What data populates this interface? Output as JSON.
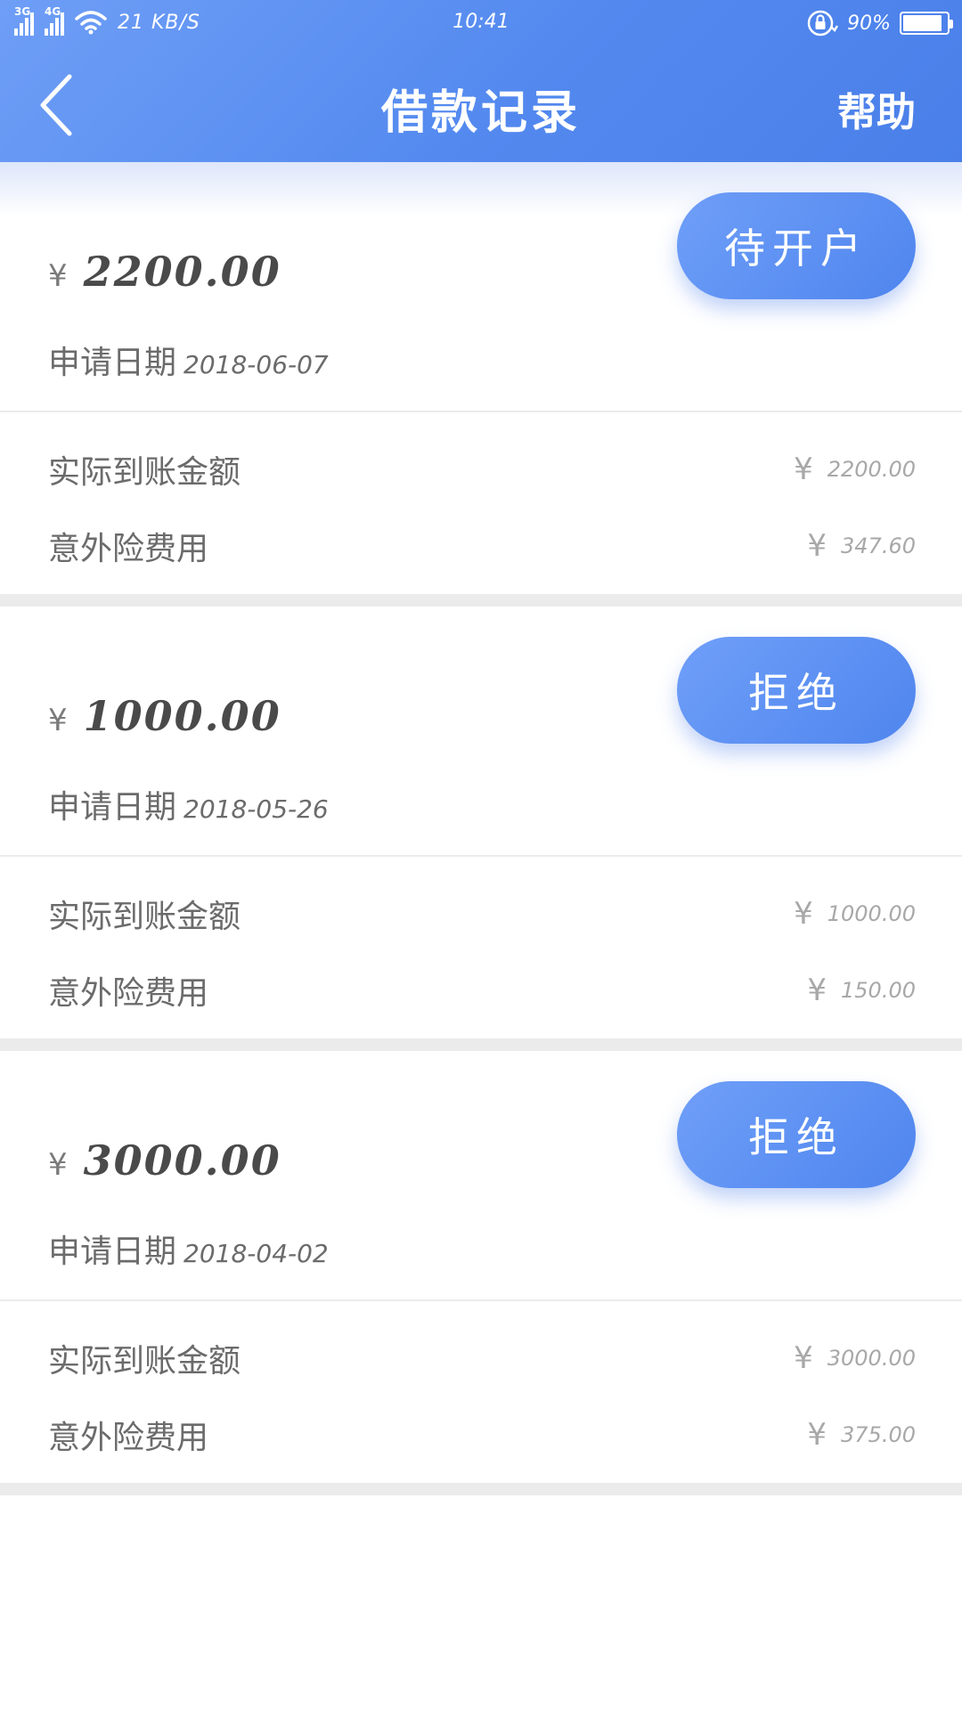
{
  "status_bar": {
    "signal1": "3G",
    "signal2": "4G",
    "net_speed": "21 KB/S",
    "time": "10:41",
    "battery_pct": "90%",
    "battery_level": 0.9
  },
  "header": {
    "title": "借款记录",
    "help": "帮助"
  },
  "labels": {
    "currency": "¥",
    "apply_date": "申请日期",
    "actual_amount": "实际到账金额",
    "insurance_fee": "意外险费用"
  },
  "records": [
    {
      "amount": "2200.00",
      "date": "2018-06-07",
      "status": "待开户",
      "actual": "2200.00",
      "insurance": "347.60"
    },
    {
      "amount": "1000.00",
      "date": "2018-05-26",
      "status": "拒绝",
      "actual": "1000.00",
      "insurance": "150.00"
    },
    {
      "amount": "3000.00",
      "date": "2018-04-02",
      "status": "拒绝",
      "actual": "3000.00",
      "insurance": "375.00"
    }
  ],
  "colors": {
    "accent": "#5389ef",
    "text_dark": "#4a4a4a",
    "text_muted": "#a8a8a8",
    "divider": "#ebebeb"
  }
}
